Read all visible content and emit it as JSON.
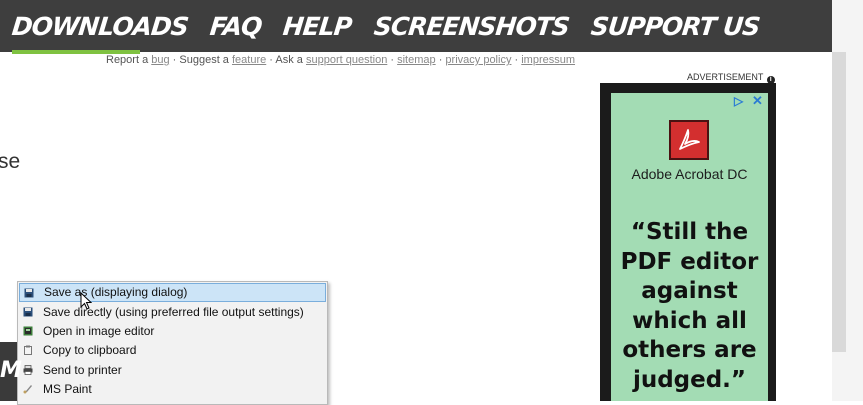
{
  "nav": {
    "items": [
      "DOWNLOADS",
      "FAQ",
      "HELP",
      "SCREENSHOTS",
      "SUPPORT US"
    ]
  },
  "subnav": {
    "report_prefix": "Report a ",
    "bug": "bug",
    "suggest_prefix": " · Suggest a ",
    "feature": "feature",
    "ask_prefix": " · Ask a ",
    "support_question": "support question",
    "sep1": " · ",
    "sitemap": "sitemap",
    "sep2": " · ",
    "privacy_policy": "privacy policy",
    "sep3": " · ",
    "impressum": "impressum"
  },
  "page": {
    "cut_text": "se"
  },
  "ad": {
    "label": "ADVERTISEMENT",
    "brand": "Adobe Acrobat DC",
    "quote_lines": [
      "“Still the",
      "PDF editor",
      "against",
      "which all",
      "others are",
      "judged.”"
    ]
  },
  "context_menu": {
    "items": [
      {
        "label": "Save as (displaying dialog)",
        "icon": "floppy-disk-icon"
      },
      {
        "label": "Save directly (using preferred file output settings)",
        "icon": "floppy-disk-icon"
      },
      {
        "label": "Open in image editor",
        "icon": "image-editor-icon"
      },
      {
        "label": "Copy to clipboard",
        "icon": "clipboard-icon"
      },
      {
        "label": "Send to printer",
        "icon": "printer-icon"
      },
      {
        "label": "MS Paint",
        "icon": "paint-brush-icon"
      }
    ]
  },
  "colors": {
    "nav_bg": "#3e3e3e",
    "nav_accent": "#7fc241",
    "ad_bg": "#a3dcb4",
    "menu_highlight": "#cce4f7"
  }
}
